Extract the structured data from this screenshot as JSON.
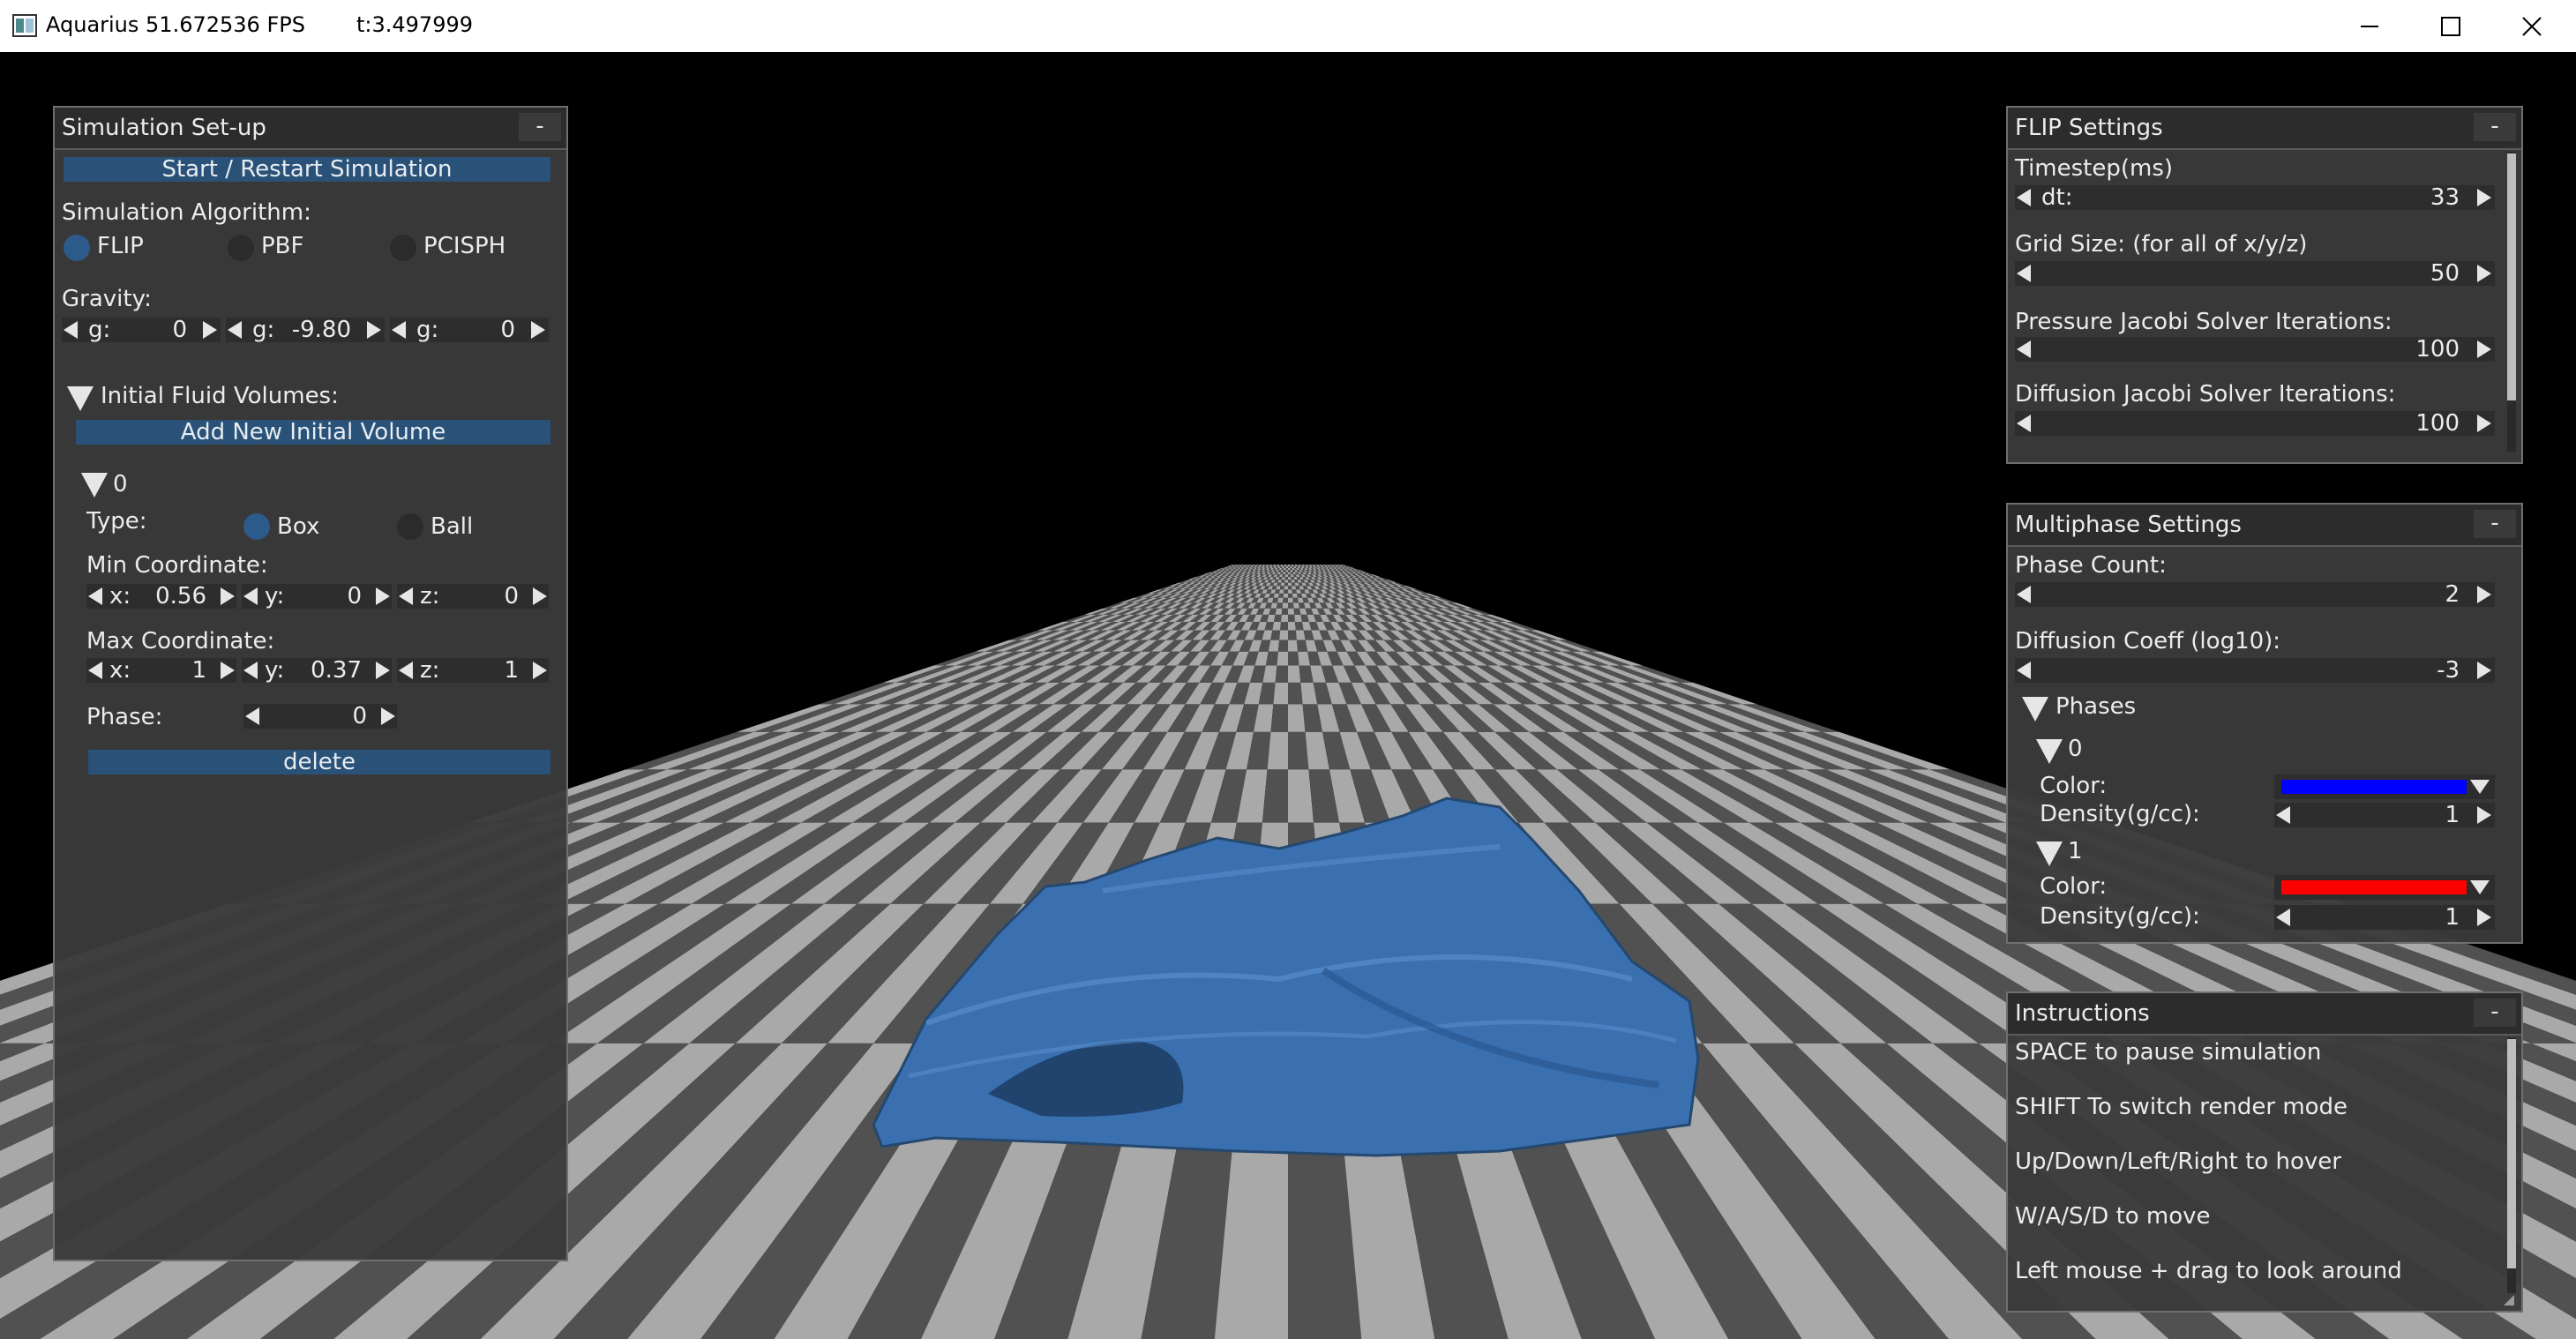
{
  "window": {
    "title": "Aquarius  51.672536 FPS",
    "time": "t:3.497999"
  },
  "colors": {
    "checker_light": "#a9a9a9",
    "checker_dark": "#515151",
    "fluid": "#3a6fb0",
    "panel_bg": "#3a3a3a",
    "button_blue": "#2a5177",
    "radio_on": "#2c5a8a",
    "phase0_color": "#0000ff",
    "phase1_color": "#ff0000"
  },
  "sim_setup": {
    "title": "Simulation Set-up",
    "collapse": "-",
    "start_button": "Start / Restart Simulation",
    "algo_label": "Simulation Algorithm:",
    "algos": [
      {
        "label": "FLIP",
        "selected": true
      },
      {
        "label": "PBF",
        "selected": false
      },
      {
        "label": "PCISPH",
        "selected": false
      }
    ],
    "gravity_label": "Gravity:",
    "gravity": [
      {
        "prefix": "g:",
        "value": "0"
      },
      {
        "prefix": "g:",
        "value": "-9.80"
      },
      {
        "prefix": "g:",
        "value": "0"
      }
    ],
    "volumes_label": "Initial Fluid Volumes:",
    "add_button": "Add New Initial Volume",
    "volume": {
      "index": "0",
      "type_label": "Type:",
      "types": [
        {
          "label": "Box",
          "selected": true
        },
        {
          "label": "Ball",
          "selected": false
        }
      ],
      "min_label": "Min Coordinate:",
      "min": [
        {
          "prefix": "x:",
          "value": "0.56"
        },
        {
          "prefix": "y:",
          "value": "0"
        },
        {
          "prefix": "z:",
          "value": "0"
        }
      ],
      "max_label": "Max Coordinate:",
      "max": [
        {
          "prefix": "x:",
          "value": "1"
        },
        {
          "prefix": "y:",
          "value": "0.37"
        },
        {
          "prefix": "z:",
          "value": "1"
        }
      ],
      "phase_label": "Phase:",
      "phase_value": "0",
      "delete_button": "delete"
    }
  },
  "flip": {
    "title": "FLIP Settings",
    "collapse": "-",
    "timestep_label": "Timestep(ms)",
    "dt_prefix": "dt:",
    "dt_value": "33",
    "grid_label": "Grid Size: (for all of x/y/z)",
    "grid_value": "50",
    "pressure_label": "Pressure Jacobi Solver Iterations:",
    "pressure_value": "100",
    "diffusion_label": "Diffusion Jacobi Solver Iterations:",
    "diffusion_value": "100"
  },
  "multiphase": {
    "title": "Multiphase Settings",
    "collapse": "-",
    "count_label": "Phase Count:",
    "count_value": "2",
    "coeff_label": "Diffusion Coeff (log10):",
    "coeff_value": "-3",
    "phases_label": "Phases",
    "phases": [
      {
        "index": "0",
        "color_label": "Color:",
        "density_label": "Density(g/cc):",
        "density": "1"
      },
      {
        "index": "1",
        "color_label": "Color:",
        "density_label": "Density(g/cc):",
        "density": "1"
      }
    ]
  },
  "instructions": {
    "title": "Instructions",
    "collapse": "-",
    "lines": [
      "SPACE to pause simulation",
      "SHIFT To switch render mode",
      "Up/Down/Left/Right to hover",
      "W/A/S/D to move",
      "Left mouse + drag to look around"
    ]
  }
}
